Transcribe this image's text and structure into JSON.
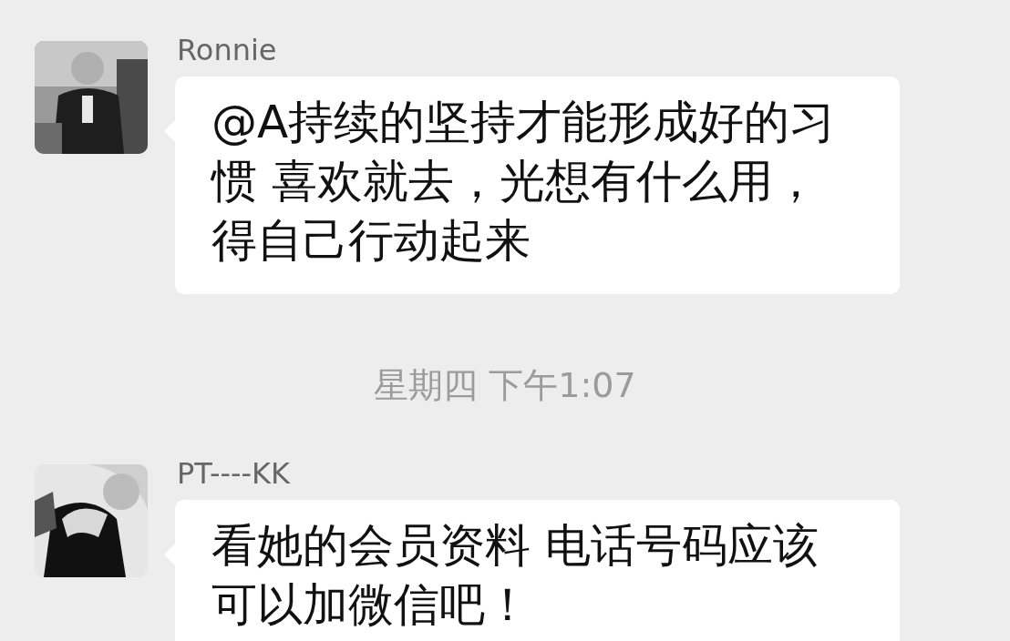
{
  "messages": [
    {
      "kind": "message",
      "sender": "Ronnie",
      "text": "@A持续的坚持才能形成好的习惯 喜欢就去，光想有什么用，得自己行动起来"
    },
    {
      "kind": "time",
      "text": "星期四 下午1:07"
    },
    {
      "kind": "message",
      "sender": "PT----KK",
      "text": "看她的会员资料 电话号码应该可以加微信吧！"
    }
  ]
}
